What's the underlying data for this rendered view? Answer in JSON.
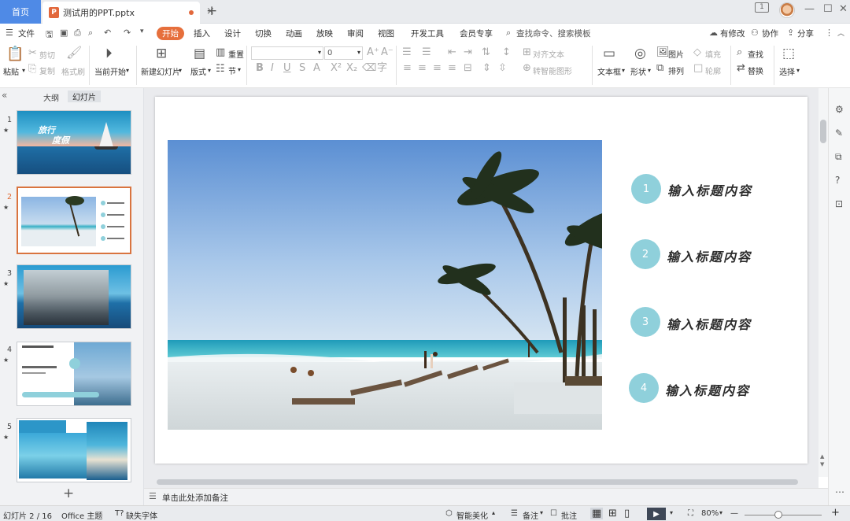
{
  "titlebar": {
    "home_tab": "首页",
    "doc_tab": "测试用的PPT.pptx",
    "ppt_logo": "P",
    "new_tab": "+",
    "badge": "1"
  },
  "menubar": {
    "file": "文件",
    "start": "开始",
    "items": [
      "插入",
      "设计",
      "切换",
      "动画",
      "放映",
      "审阅",
      "视图",
      "开发工具",
      "会员专享"
    ],
    "search": "查找命令、搜索模板",
    "right": [
      "有修改",
      "协作",
      "分享"
    ]
  },
  "ribbon": {
    "paste": "粘贴",
    "cut": "剪切",
    "copy": "复制",
    "format_painter": "格式刷",
    "from_current": "当前开始",
    "new_slide": "新建幻灯片",
    "layout": "版式",
    "reset": "重置",
    "section": "节",
    "font_size": "0",
    "align_text": "对齐文本",
    "smart_shape": "转智能图形",
    "textbox": "文本框",
    "shape": "形状",
    "picture": "图片",
    "fill": "填充",
    "arrange": "排列",
    "outline": "轮廓",
    "find": "查找",
    "replace": "替换",
    "select": "选择"
  },
  "leftpanel": {
    "tab_outline": "大纲",
    "tab_slides": "幻灯片",
    "slides": [
      {
        "num": "1",
        "star": "★",
        "title": "旅行",
        "subtitle": "度假"
      },
      {
        "num": "2",
        "star": "★"
      },
      {
        "num": "3",
        "star": "★"
      },
      {
        "num": "4",
        "star": "★"
      },
      {
        "num": "5",
        "star": "★"
      }
    ],
    "add": "+"
  },
  "slide": {
    "items": [
      {
        "num": "1",
        "title": "输入标题内容"
      },
      {
        "num": "2",
        "title": "输入标题内容"
      },
      {
        "num": "3",
        "title": "输入标题内容"
      },
      {
        "num": "4",
        "title": "输入标题内容"
      }
    ]
  },
  "notes": {
    "placeholder": "单击此处添加备注"
  },
  "statusbar": {
    "slide_counter": "幻灯片 2 / 16",
    "theme": "Office 主题",
    "missing_font": "缺失字体",
    "smart_beautify": "智能美化",
    "notes": "备注",
    "comments": "批注",
    "zoom": "80%"
  },
  "colors": {
    "accent": "#e66f3c",
    "home_tab": "#4f8ae6",
    "circle": "#8fd0db"
  }
}
